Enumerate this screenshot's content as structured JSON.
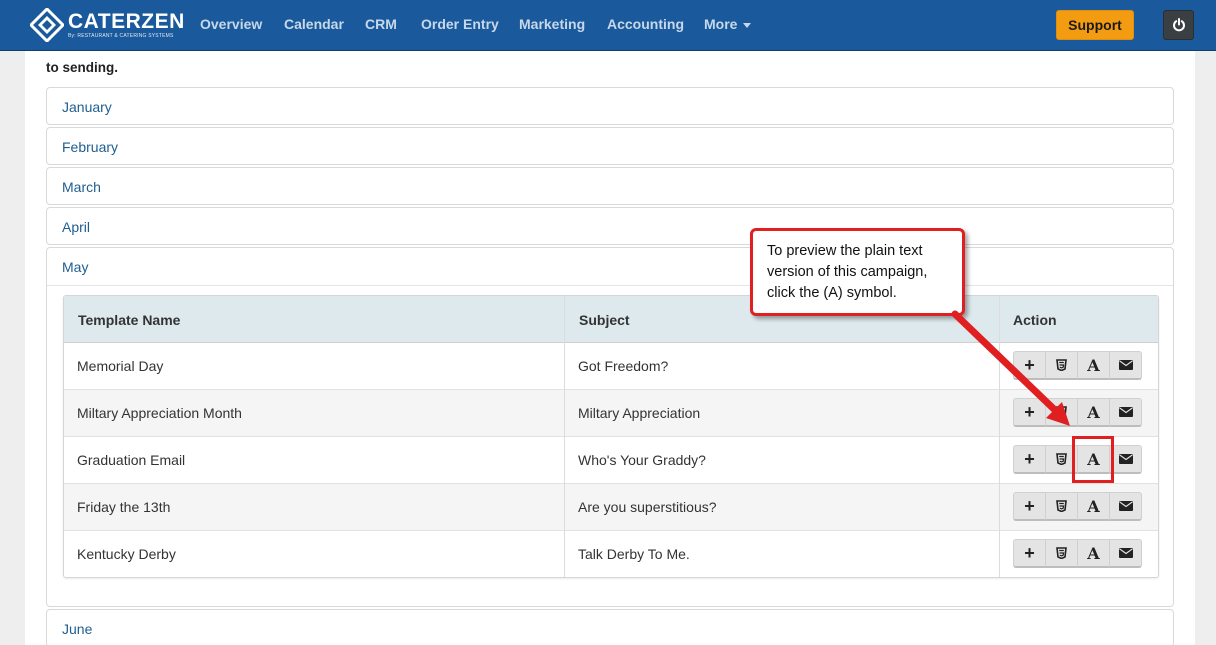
{
  "app": {
    "logo_name": "CATERZEN",
    "logo_sub": "By: RESTAURANT & CATERING SYSTEMS"
  },
  "nav": {
    "items": [
      "Overview",
      "Calendar",
      "CRM",
      "Order Entry",
      "Marketing",
      "Accounting",
      "More"
    ],
    "support_label": "Support"
  },
  "intro_text": "to sending.",
  "months_before": [
    "January",
    "February",
    "March",
    "April"
  ],
  "open_month": "May",
  "months_after": [
    "June"
  ],
  "table": {
    "headers": [
      "Template Name",
      "Subject",
      "Action"
    ],
    "rows": [
      {
        "name": "Memorial Day",
        "subject": "Got Freedom?"
      },
      {
        "name": "Miltary Appreciation Month",
        "subject": "Miltary Appreciation"
      },
      {
        "name": "Graduation Email",
        "subject": "Who's Your Graddy?"
      },
      {
        "name": "Friday the 13th",
        "subject": "Are you superstitious?"
      },
      {
        "name": "Kentucky Derby",
        "subject": "Talk Derby To Me."
      }
    ],
    "action_icons": [
      "plus-icon",
      "html5-icon",
      "plain-text-icon",
      "envelope-icon"
    ]
  },
  "callout": {
    "line1": "To preview the plain text",
    "line2": "version of this campaign,",
    "line3": "click the (A) symbol."
  },
  "colors": {
    "navbar": "#1a5a9c",
    "support": "#f39c12",
    "callout_border": "#e02020",
    "link": "#1e5e8e"
  }
}
